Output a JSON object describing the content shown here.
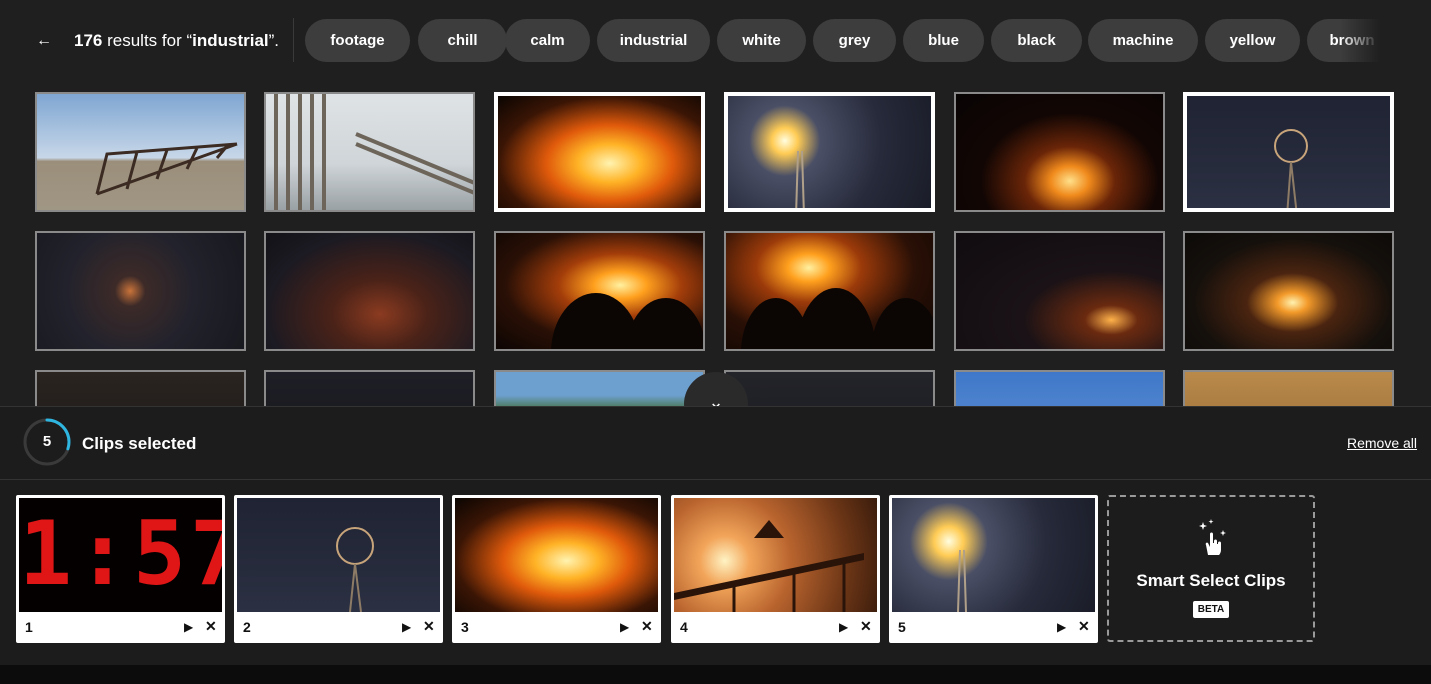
{
  "header": {
    "back_icon": "arrow-left-icon",
    "back_glyph": "←",
    "result_count": "176",
    "result_text": " results for “",
    "query": "industrial",
    "result_suffix": "”.",
    "tags": [
      "footage",
      "chill",
      "calm",
      "industrial",
      "white",
      "grey",
      "blue",
      "black",
      "machine",
      "yellow",
      "brown"
    ]
  },
  "grid": {
    "rows": [
      [
        {
          "scene": "beach gate under blue sky",
          "selected": false
        },
        {
          "scene": "fence poles by the sea",
          "selected": false
        },
        {
          "scene": "bonfire close-up",
          "selected": true
        },
        {
          "scene": "flare on metal tower at night",
          "selected": true
        },
        {
          "scene": "bonfire in dark",
          "selected": false
        },
        {
          "scene": "geodesic sphere on tower at night",
          "selected": true
        }
      ],
      [
        {
          "scene": "dark industrial building at night",
          "selected": false
        },
        {
          "scene": "crowd with sculpture at night",
          "selected": false
        },
        {
          "scene": "silhouettes by bonfire",
          "selected": false
        },
        {
          "scene": "silhouettes by bonfire",
          "selected": false
        },
        {
          "scene": "crowd at night with lights",
          "selected": false
        },
        {
          "scene": "people around fire",
          "selected": false
        }
      ],
      [
        {
          "scene": "night scene",
          "selected": false
        },
        {
          "scene": "night scene",
          "selected": false
        },
        {
          "scene": "green hill",
          "selected": false
        },
        {
          "scene": "dark structure",
          "selected": false
        },
        {
          "scene": "power lines blue sky",
          "selected": false
        },
        {
          "scene": "smoke at dusk",
          "selected": false
        }
      ]
    ],
    "expand_icon": "chevron-down-icon",
    "expand_glyph": "⌄"
  },
  "selection": {
    "count": "5",
    "progress_fraction": 0.3,
    "label": "Clips selected",
    "remove_all": "Remove all",
    "clips": [
      {
        "number": "1",
        "display": "1:57",
        "scene": "red digital clock"
      },
      {
        "number": "2",
        "scene": "geodesic sphere on tower at night"
      },
      {
        "number": "3",
        "scene": "bonfire close-up"
      },
      {
        "number": "4",
        "scene": "industrial crane at sunset"
      },
      {
        "number": "5",
        "scene": "flare on metal tower at night"
      }
    ],
    "play_icon": "play-icon",
    "play_glyph": "▶",
    "remove_icon": "close-icon",
    "remove_glyph": "✕",
    "smart_select": {
      "icon": "sparkle-hand-icon",
      "title": "Smart Select Clips",
      "badge": "BETA"
    }
  },
  "colors": {
    "background": "#1f1f1f",
    "tag_bg": "#3d3d3d",
    "ring_accent": "#2fb6e0",
    "selected_border": "#ffffff"
  }
}
